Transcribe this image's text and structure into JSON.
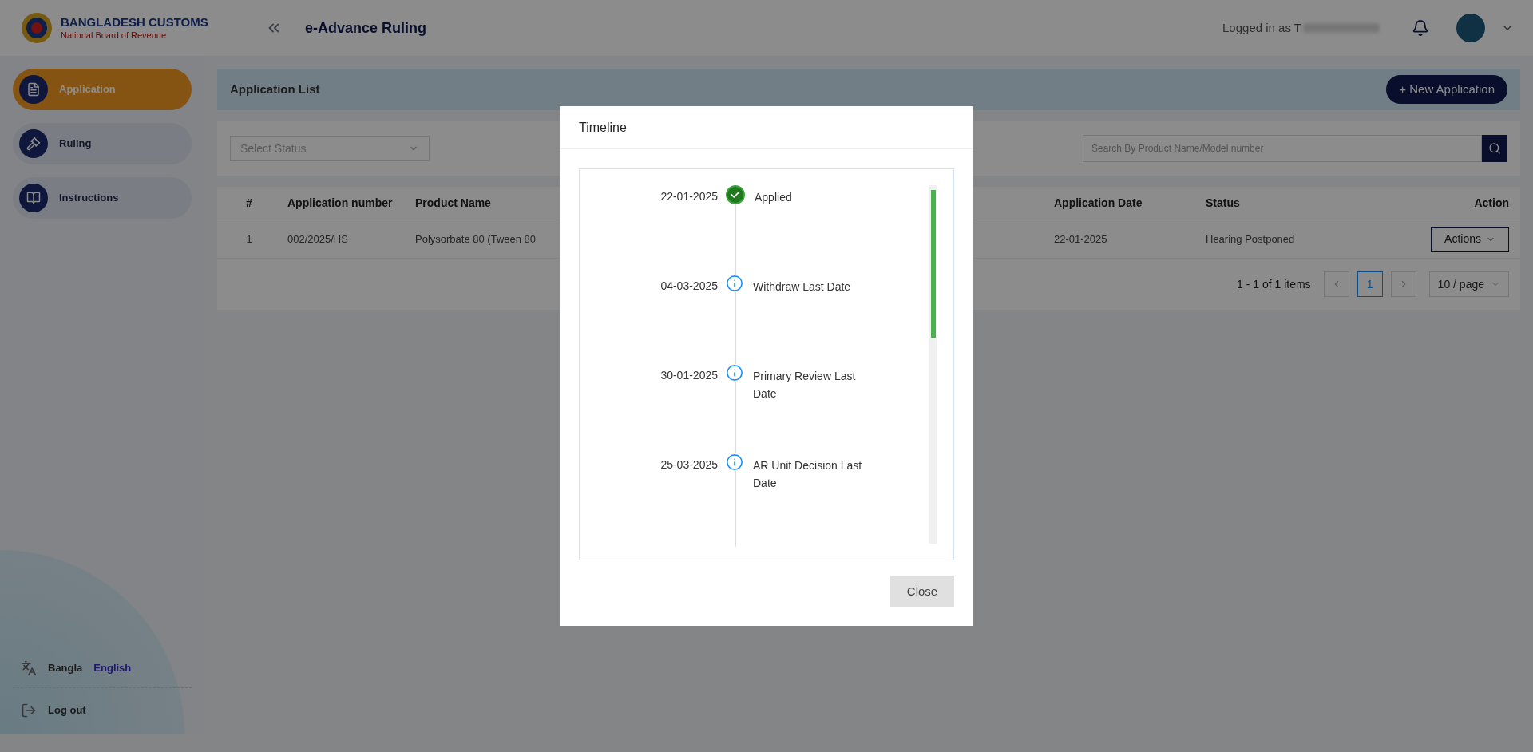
{
  "brand": {
    "title": "BANGLADESH CUSTOMS",
    "subtitle": "National Board of Revenue"
  },
  "header": {
    "app_title": "e-Advance Ruling",
    "logged_in_label": "Logged in as T"
  },
  "sidebar": {
    "items": [
      {
        "label": "Application",
        "selected": true
      },
      {
        "label": "Ruling",
        "selected": false
      },
      {
        "label": "Instructions",
        "selected": false
      }
    ],
    "languages": [
      {
        "label": "Bangla",
        "selected": false
      },
      {
        "label": "English",
        "selected": true
      }
    ],
    "logout": "Log out"
  },
  "page": {
    "title": "Application List",
    "new_button": "+ New Application"
  },
  "filters": {
    "status_placeholder": "Select Status",
    "search_placeholder": "Search By Product Name/Model number"
  },
  "table": {
    "columns": [
      "#",
      "Application number",
      "Product Name",
      "Application Date",
      "Status",
      "Action"
    ],
    "rows": [
      {
        "index": "1",
        "application_number": "002/2025/HS",
        "product_name": "Polysorbate 80 (Tween 80",
        "application_date": "22-01-2025",
        "status": "Hearing Postponed",
        "action": "Actions"
      }
    ]
  },
  "pagination": {
    "summary": "1 - 1 of 1 items",
    "pages": [
      {
        "label": "1",
        "selected": true
      }
    ],
    "page_size": "10 / page"
  },
  "modal": {
    "title": "Timeline",
    "close": "Close",
    "events": [
      {
        "date": "22-01-2025",
        "label": "Applied",
        "kind": "done"
      },
      {
        "date": "04-03-2025",
        "label": "Withdraw Last Date",
        "kind": "info"
      },
      {
        "date": "30-01-2025",
        "label": "Primary Review Last Date",
        "kind": "info"
      },
      {
        "date": "25-03-2025",
        "label": "AR Unit Decision Last Date",
        "kind": "info"
      }
    ]
  }
}
